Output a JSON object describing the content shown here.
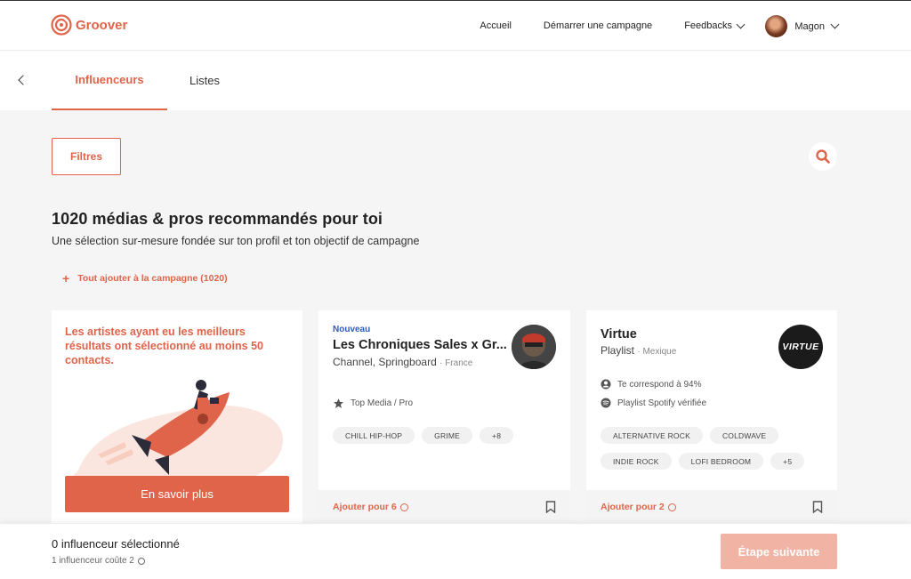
{
  "header": {
    "logo_text": "Groover",
    "nav": [
      "Accueil",
      "Démarrer une campagne",
      "Feedbacks"
    ],
    "user_name": "Magon"
  },
  "tabs": {
    "items": [
      "Influenceurs",
      "Listes"
    ],
    "active": "Influenceurs"
  },
  "toolbar": {
    "filters_label": "Filtres"
  },
  "main": {
    "headline": "1020 médias & pros recommandés pour toi",
    "subline": "Une sélection sur-mesure fondée sur ton profil et ton objectif de campagne",
    "add_all_label": "Tout ajouter à la campagne (1020)"
  },
  "promo": {
    "text": "Les artistes ayant eu les meilleurs résultats ont sélectionné au moins 50 contacts.",
    "button": "En savoir plus"
  },
  "cards": [
    {
      "badge": "Nouveau",
      "name": "Les Chroniques Sales x Gr...",
      "type": "Channel, Springboard",
      "country": "France",
      "features": [
        "Top Media / Pro"
      ],
      "tags": [
        "CHILL HIP-HOP",
        "GRIME",
        "+8"
      ],
      "add_label": "Ajouter pour 6"
    },
    {
      "name": "Virtue",
      "type": "Playlist",
      "country": "Mexique",
      "avatar_text": "VIRTUE",
      "features": [
        "Te correspond à 94%",
        "Playlist Spotify vérifiée"
      ],
      "tags": [
        "ALTERNATIVE ROCK",
        "COLDWAVE",
        "INDIE ROCK",
        "LOFI BEDROOM",
        "+5"
      ],
      "add_label": "Ajouter pour 2"
    }
  ],
  "footer": {
    "selected": "0 influenceur sélectionné",
    "cost": "1 influenceur coûte 2",
    "next_button": "Étape suivante"
  },
  "colors": {
    "accent": "#e0644a",
    "accent_disabled": "#f0b3a4",
    "new_badge": "#2f5bb7"
  }
}
